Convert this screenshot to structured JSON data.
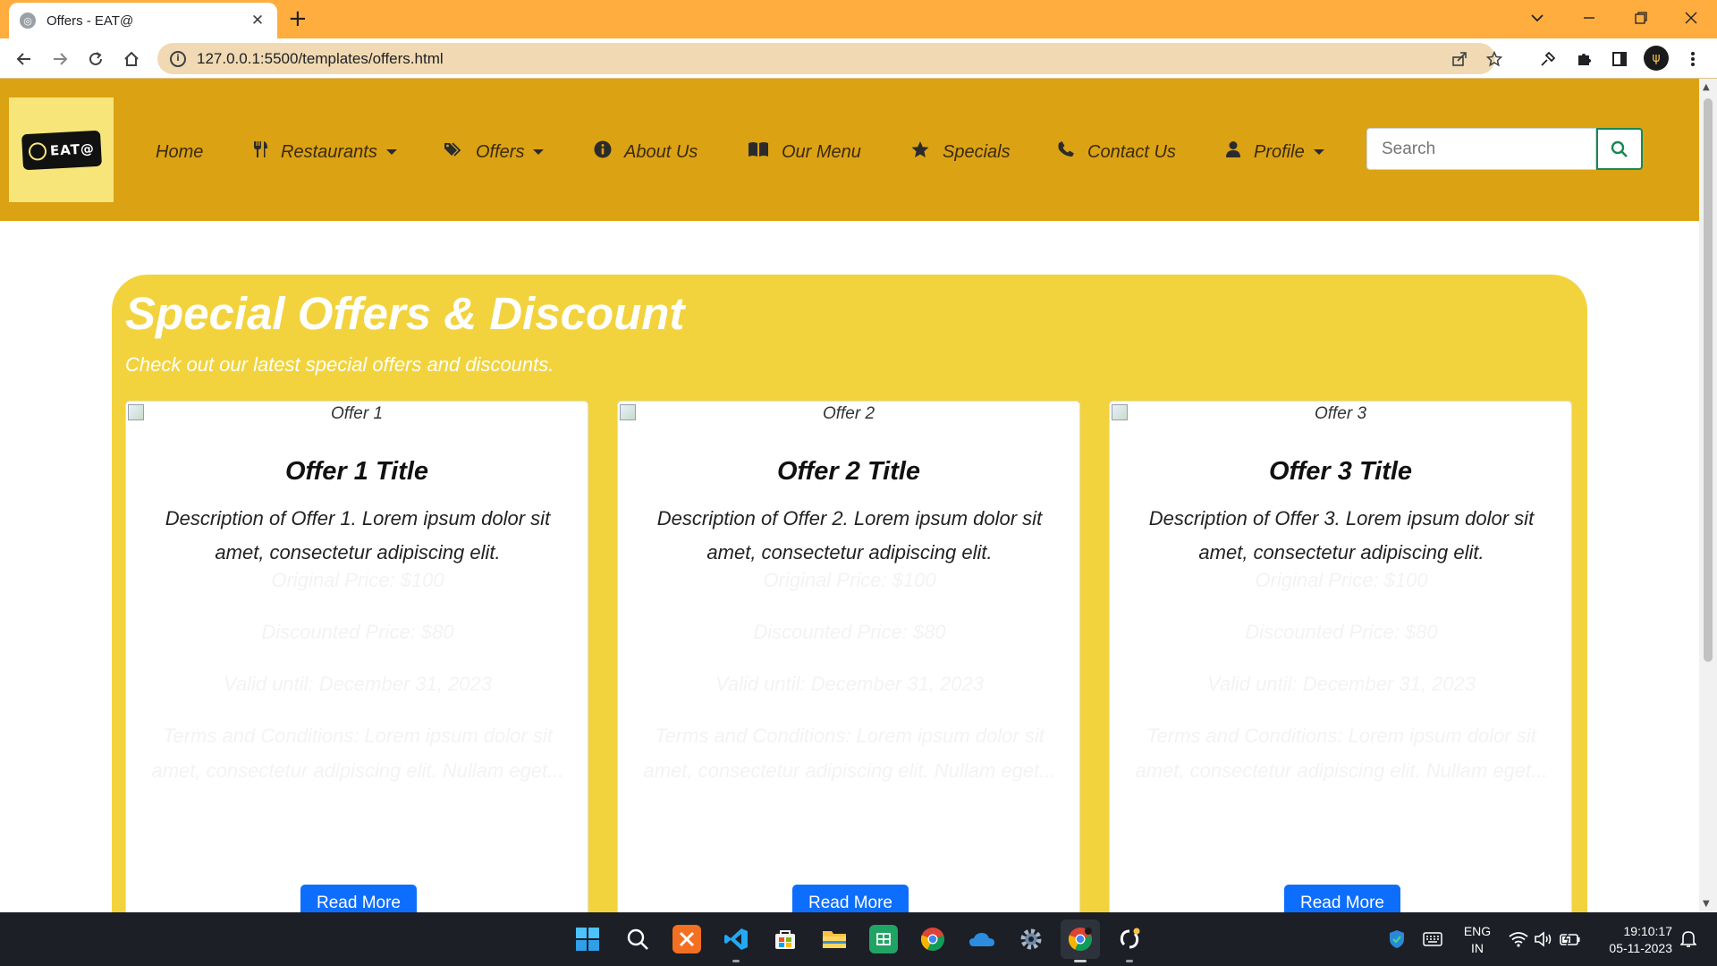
{
  "browser": {
    "tab_title": "Offers - EAT@",
    "url": "127.0.0.1:5500/templates/offers.html"
  },
  "site": {
    "logo_text": "EAT@",
    "nav": [
      {
        "label": "Home",
        "icon": "",
        "dropdown": false
      },
      {
        "label": "Restaurants",
        "icon": "utensils-icon",
        "dropdown": true
      },
      {
        "label": "Offers",
        "icon": "tags-icon",
        "dropdown": true
      },
      {
        "label": "About Us",
        "icon": "info-circle-icon",
        "dropdown": false
      },
      {
        "label": "Our Menu",
        "icon": "book-open-icon",
        "dropdown": false
      },
      {
        "label": "Specials",
        "icon": "star-icon",
        "dropdown": false
      },
      {
        "label": "Contact Us",
        "icon": "phone-icon",
        "dropdown": false
      },
      {
        "label": "Profile",
        "icon": "user-icon",
        "dropdown": true
      }
    ],
    "search_placeholder": "Search"
  },
  "offers": {
    "title": "Special Offers & Discount",
    "subtitle": "Check out our latest special offers and discounts.",
    "cards": [
      {
        "img_alt": "Offer 1",
        "title": "Offer 1 Title",
        "description": "Description of Offer 1. Lorem ipsum dolor sit amet, consectetur adipiscing elit.",
        "original_price": "Original Price: $100",
        "discounted_price": "Discounted Price: $80",
        "valid_until": "Valid until: December 31, 2023",
        "terms": "Terms and Conditions: Lorem ipsum dolor sit amet, consectetur adipiscing elit. Nullam eget...",
        "button": "Read More"
      },
      {
        "img_alt": "Offer 2",
        "title": "Offer 2 Title",
        "description": "Description of Offer 2. Lorem ipsum dolor sit amet, consectetur adipiscing elit.",
        "original_price": "Original Price: $100",
        "discounted_price": "Discounted Price: $80",
        "valid_until": "Valid until: December 31, 2023",
        "terms": "Terms and Conditions: Lorem ipsum dolor sit amet, consectetur adipiscing elit. Nullam eget...",
        "button": "Read More"
      },
      {
        "img_alt": "Offer 3",
        "title": "Offer 3 Title",
        "description": "Description of Offer 3. Lorem ipsum dolor sit amet, consectetur adipiscing elit.",
        "original_price": "Original Price: $100",
        "discounted_price": "Discounted Price: $80",
        "valid_until": "Valid until: December 31, 2023",
        "terms": "Terms and Conditions: Lorem ipsum dolor sit amet, consectetur adipiscing elit. Nullam eget...",
        "button": "Read More"
      }
    ]
  },
  "taskbar": {
    "lang_top": "ENG",
    "lang_bottom": "IN",
    "time": "19:10:17",
    "date": "05-11-2023"
  },
  "colors": {
    "tabbar": "#ffad3f",
    "navbar": "#dba214",
    "panel": "#f2d33e",
    "button": "#0d6efd",
    "search_border": "#198754"
  }
}
